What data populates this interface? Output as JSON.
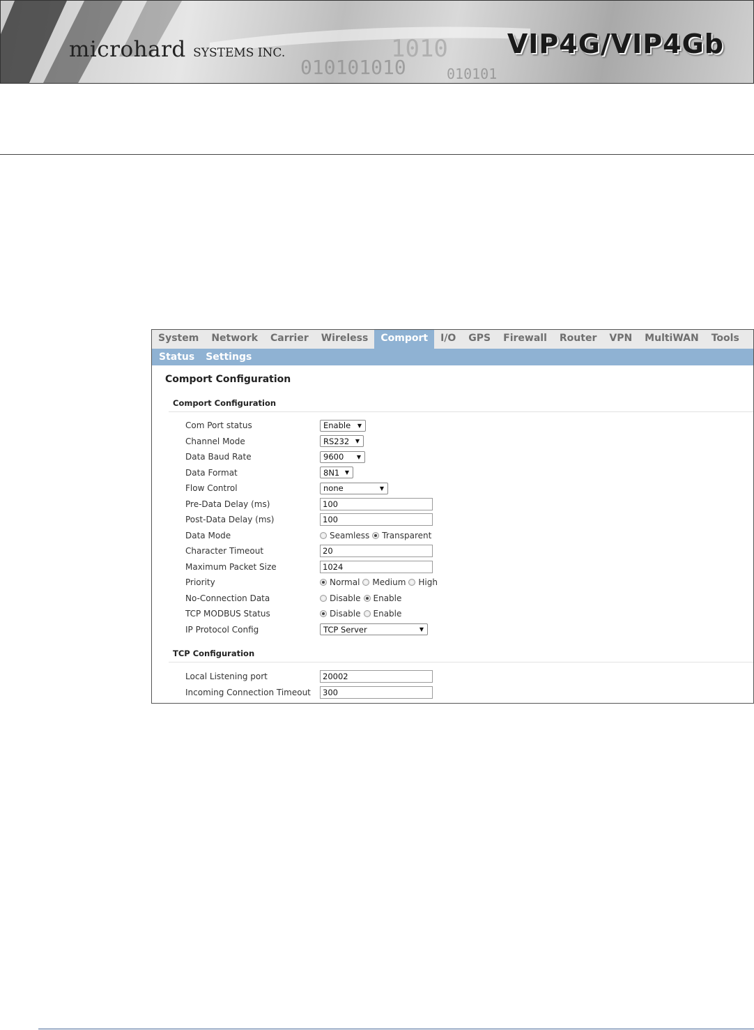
{
  "banner": {
    "brand_main": "microhard",
    "brand_sub": "SYSTEMS INC.",
    "product": "VIP4G/VIP4Gb"
  },
  "nav": {
    "tabs": [
      {
        "label": "System",
        "active": false
      },
      {
        "label": "Network",
        "active": false
      },
      {
        "label": "Carrier",
        "active": false
      },
      {
        "label": "Wireless",
        "active": false
      },
      {
        "label": "Comport",
        "active": true
      },
      {
        "label": "I/O",
        "active": false
      },
      {
        "label": "GPS",
        "active": false
      },
      {
        "label": "Firewall",
        "active": false
      },
      {
        "label": "Router",
        "active": false
      },
      {
        "label": "VPN",
        "active": false
      },
      {
        "label": "MultiWAN",
        "active": false
      },
      {
        "label": "Tools",
        "active": false
      }
    ],
    "subtabs": [
      {
        "label": "Status"
      },
      {
        "label": "Settings"
      }
    ]
  },
  "page": {
    "title": "Comport Configuration"
  },
  "comport": {
    "section_title": "Comport Configuration",
    "com_port_status": {
      "label": "Com Port status",
      "value": "Enable"
    },
    "channel_mode": {
      "label": "Channel Mode",
      "value": "RS232"
    },
    "data_baud_rate": {
      "label": "Data Baud Rate",
      "value": "9600"
    },
    "data_format": {
      "label": "Data Format",
      "value": "8N1"
    },
    "flow_control": {
      "label": "Flow Control",
      "value": "none"
    },
    "pre_data_delay": {
      "label": "Pre-Data Delay (ms)",
      "value": "100"
    },
    "post_data_delay": {
      "label": "Post-Data Delay (ms)",
      "value": "100"
    },
    "data_mode": {
      "label": "Data Mode",
      "options": [
        "Seamless",
        "Transparent"
      ],
      "selected": "Transparent"
    },
    "character_timeout": {
      "label": "Character Timeout",
      "value": "20"
    },
    "max_packet_size": {
      "label": "Maximum Packet Size",
      "value": "1024"
    },
    "priority": {
      "label": "Priority",
      "options": [
        "Normal",
        "Medium",
        "High"
      ],
      "selected": "Normal"
    },
    "no_connection_data": {
      "label": "No-Connection Data",
      "options": [
        "Disable",
        "Enable"
      ],
      "selected": "Enable"
    },
    "tcp_modbus_status": {
      "label": "TCP MODBUS Status",
      "options": [
        "Disable",
        "Enable"
      ],
      "selected": "Disable"
    },
    "ip_protocol_config": {
      "label": "IP Protocol Config",
      "value": "TCP Server"
    }
  },
  "tcp": {
    "section_title": "TCP Configuration",
    "local_listening_port": {
      "label": "Local Listening port",
      "value": "20002"
    },
    "incoming_connection_timeout": {
      "label": "Incoming Connection Timeout",
      "value": "300"
    }
  }
}
